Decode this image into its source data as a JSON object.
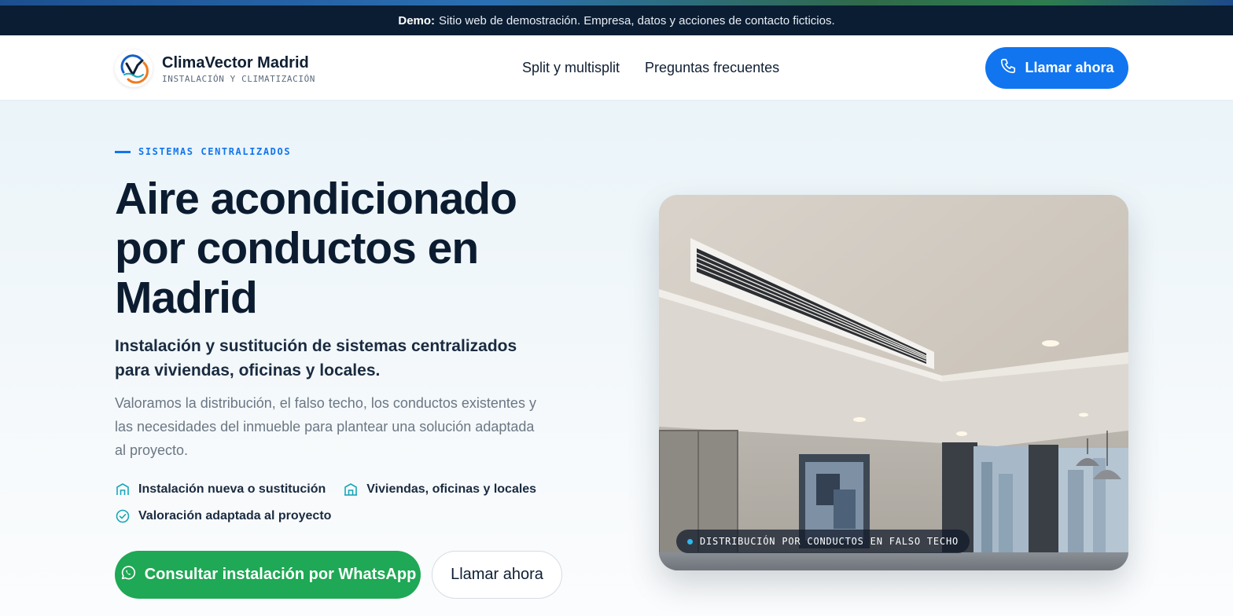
{
  "demo_banner": {
    "label": "Demo:",
    "text": "Sitio web de demostración. Empresa, datos y acciones de contacto ficticios."
  },
  "header": {
    "brand": "ClimaVector Madrid",
    "tagline": "INSTALACIÓN Y CLIMATIZACIÓN",
    "nav": [
      {
        "label": "Split y multisplit"
      },
      {
        "label": "Preguntas frecuentes"
      }
    ],
    "call_button": "Llamar ahora"
  },
  "hero": {
    "eyebrow": "SISTEMAS CENTRALIZADOS",
    "title": "Aire acondicionado por conductos en Madrid",
    "subtitle": "Instalación y sustitución de sistemas centralizados para viviendas, oficinas y locales.",
    "description": "Valoramos la distribución, el falso techo, los conductos existentes y las necesidades del inmueble para plantear una solución adaptada al proyecto.",
    "features": [
      {
        "icon": "building-icon",
        "label": "Instalación nueva o sustitución"
      },
      {
        "icon": "building-icon",
        "label": "Viviendas, oficinas y locales"
      },
      {
        "icon": "check-circle-icon",
        "label": "Valoración adaptada al proyecto"
      }
    ],
    "whatsapp_button": "Consultar instalación por WhatsApp",
    "call_button": "Llamar ahora",
    "photo_caption": "DISTRIBUCIÓN POR CONDUCTOS EN FALSO TECHO"
  },
  "colors": {
    "accent": "#1175f0",
    "whatsapp": "#1fa855",
    "dark": "#0b1d33",
    "icon_teal": "#19a6b8"
  }
}
